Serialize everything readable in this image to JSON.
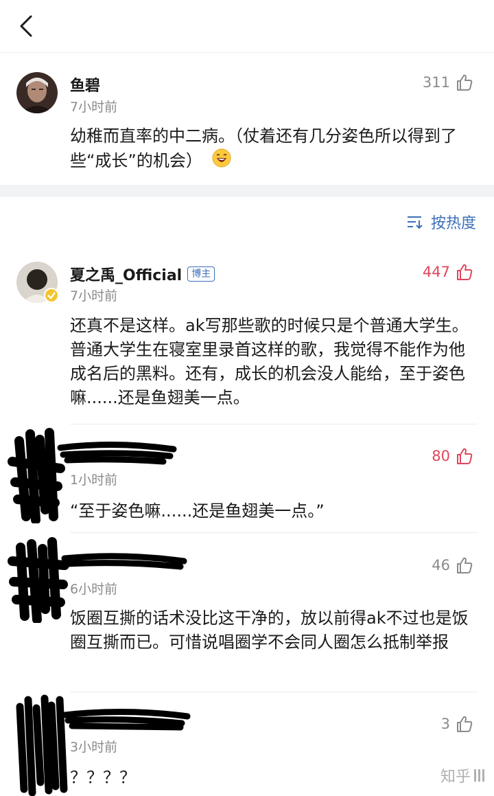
{
  "parent": {
    "author": "鱼碧",
    "time": "7小时前",
    "likes": "311",
    "content": "幼稚而直率的中二病。（仗着还有几分姿色所以得到了些“成长”的机会）"
  },
  "sort_label": "按热度",
  "replies": [
    {
      "author": "夏之禹_Official",
      "badge": "博主",
      "time": "7小时前",
      "likes": "447",
      "content": "还真不是这样。ak写那些歌的时候只是个普通大学生。普通大学生在寝室里录首这样的歌，我觉得不能作为他成名后的黑料。还有，成长的机会没人能给，至于姿色嘛......还是鱼翅美一点。"
    },
    {
      "time": "1小时前",
      "likes": "80",
      "content": "“至于姿色嘛......还是鱼翅美一点。”"
    },
    {
      "time": "6小时前",
      "likes": "46",
      "content": "饭圈互撕的话术没比这干净的，放以前得ak不过也是饭圈互撕而已。可惜说唱圈学不会同人圈怎么抵制举报"
    },
    {
      "time": "3小时前",
      "likes": "3",
      "content": "？？？？"
    }
  ],
  "watermark": "知乎",
  "colors": {
    "accent": "#3b6fb6",
    "like_hot": "#e0465c",
    "muted": "#8a8a8a"
  }
}
